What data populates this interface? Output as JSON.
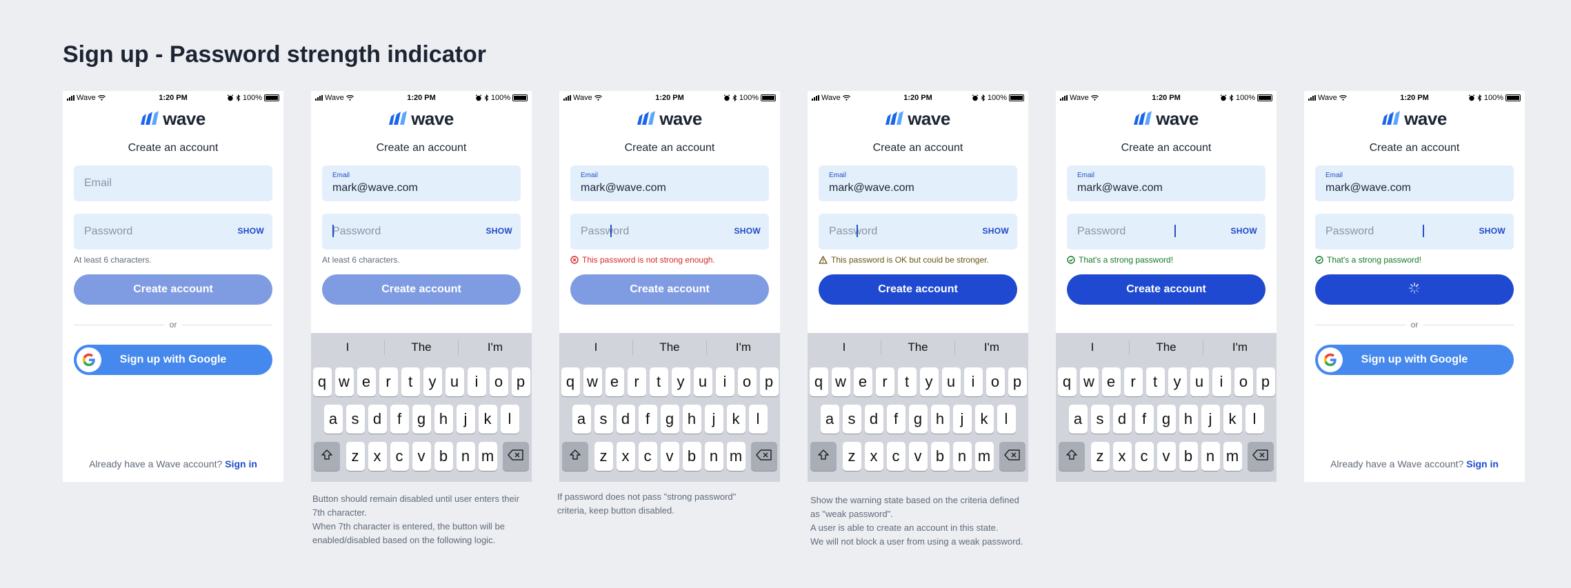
{
  "page_title": "Sign up - Password strength indicator",
  "status_bar": {
    "carrier": "Wave",
    "time": "1:20 PM",
    "battery": "100%"
  },
  "brand": "wave",
  "card_title": "Create an account",
  "email_placeholder": "Email",
  "email_label": "Email",
  "email_value": "mark@wave.com",
  "password_placeholder": "Password",
  "show_label": "SHOW",
  "create_label": "Create account",
  "divider_label": "or",
  "google_label": "Sign up with Google",
  "signin_prompt": "Already have a Wave account?",
  "signin_link": "Sign in",
  "hints": {
    "min": "At least 6 characters.",
    "error": "This password is not strong enough.",
    "warn": "This password is OK but could be stronger.",
    "ok": "That's a strong password!"
  },
  "keyboard": {
    "suggestions": [
      "I",
      "The",
      "I'm"
    ],
    "row1": [
      "q",
      "w",
      "e",
      "r",
      "t",
      "y",
      "u",
      "i",
      "o",
      "p"
    ],
    "row2": [
      "a",
      "s",
      "d",
      "f",
      "g",
      "h",
      "j",
      "k",
      "l"
    ],
    "row3": [
      "z",
      "x",
      "c",
      "v",
      "b",
      "n",
      "m"
    ]
  },
  "captions": {
    "screen2": [
      "Button should remain disabled until user enters their 7th character.",
      "When 7th character is entered, the button will be enabled/disabled based on the following logic."
    ],
    "screen3": [
      "If password does not pass \"strong password\" criteria, keep button disabled."
    ],
    "screen4": [
      "Show the warning state based on the criteria defined as \"weak password\".",
      "A user is able to create an account in this state.",
      "We will not block a user from using a weak password."
    ]
  },
  "colors": {
    "primary": "#1e49d0",
    "disabled": "#7f9be2",
    "google": "#4588ee",
    "field": "#e3f0fc",
    "error": "#d32a2a",
    "success": "#147a2a"
  }
}
